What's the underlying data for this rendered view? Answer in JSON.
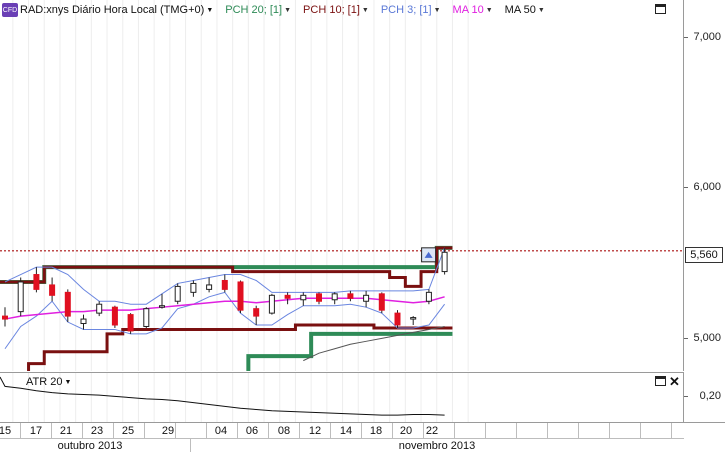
{
  "header": {
    "badge": "CFD",
    "symbol": "RAD:xnys Diário Hora Local (TMG+0)",
    "indicators": [
      {
        "label": "PCH 20; [1]",
        "color": "#2e8b57"
      },
      {
        "label": "PCH 10; [1]",
        "color": "#7a1010"
      },
      {
        "label": "PCH 3; [1]",
        "color": "#5a78d6"
      },
      {
        "label": "MA 10",
        "color": "#e020e0"
      },
      {
        "label": "MA 50",
        "color": "#111111"
      }
    ]
  },
  "price_axis": {
    "labels": [
      "7,000",
      "6,000",
      "5,000"
    ],
    "current_price": "5,560"
  },
  "atr": {
    "label": "ATR 20",
    "axis_label": "0,20"
  },
  "time_axis": {
    "days": [
      "15",
      "17",
      "21",
      "23",
      "25",
      "29",
      "04",
      "06",
      "08",
      "12",
      "14",
      "18",
      "20",
      "22"
    ],
    "months": [
      "outubro 2013",
      "novembro 2013"
    ]
  },
  "chart_data": {
    "type": "candlestick",
    "x": [
      "15",
      "16",
      "17",
      "18",
      "21",
      "22",
      "23",
      "24",
      "25",
      "28",
      "29",
      "30",
      "31",
      "01",
      "04",
      "05",
      "06",
      "07",
      "08",
      "11",
      "12",
      "13",
      "14",
      "15",
      "18",
      "19",
      "20",
      "21",
      "22"
    ],
    "candles": [
      {
        "o": 5.12,
        "h": 5.18,
        "l": 5.05,
        "c": 5.1,
        "up": false
      },
      {
        "o": 5.15,
        "h": 5.38,
        "l": 5.12,
        "c": 5.35,
        "up": true
      },
      {
        "o": 5.4,
        "h": 5.45,
        "l": 5.28,
        "c": 5.3,
        "up": false
      },
      {
        "o": 5.33,
        "h": 5.38,
        "l": 5.22,
        "c": 5.26,
        "up": false
      },
      {
        "o": 5.28,
        "h": 5.3,
        "l": 5.08,
        "c": 5.12,
        "up": false
      },
      {
        "o": 5.07,
        "h": 5.13,
        "l": 5.03,
        "c": 5.1,
        "up": true
      },
      {
        "o": 5.14,
        "h": 5.22,
        "l": 5.12,
        "c": 5.2,
        "up": true
      },
      {
        "o": 5.18,
        "h": 5.19,
        "l": 5.04,
        "c": 5.06,
        "up": false
      },
      {
        "o": 5.13,
        "h": 5.14,
        "l": 5.0,
        "c": 5.02,
        "up": false
      },
      {
        "o": 5.05,
        "h": 5.18,
        "l": 5.04,
        "c": 5.17,
        "up": true
      },
      {
        "o": 5.18,
        "h": 5.27,
        "l": 5.17,
        "c": 5.19,
        "up": true
      },
      {
        "o": 5.22,
        "h": 5.34,
        "l": 5.2,
        "c": 5.32,
        "up": true
      },
      {
        "o": 5.28,
        "h": 5.36,
        "l": 5.25,
        "c": 5.34,
        "up": true
      },
      {
        "o": 5.3,
        "h": 5.38,
        "l": 5.28,
        "c": 5.33,
        "up": true
      },
      {
        "o": 5.36,
        "h": 5.4,
        "l": 5.28,
        "c": 5.3,
        "up": false
      },
      {
        "o": 5.35,
        "h": 5.36,
        "l": 5.14,
        "c": 5.16,
        "up": false
      },
      {
        "o": 5.17,
        "h": 5.19,
        "l": 5.06,
        "c": 5.12,
        "up": false
      },
      {
        "o": 5.14,
        "h": 5.27,
        "l": 5.13,
        "c": 5.26,
        "up": true
      },
      {
        "o": 5.26,
        "h": 5.28,
        "l": 5.2,
        "c": 5.24,
        "up": false
      },
      {
        "o": 5.23,
        "h": 5.28,
        "l": 5.19,
        "c": 5.26,
        "up": true
      },
      {
        "o": 5.27,
        "h": 5.28,
        "l": 5.2,
        "c": 5.22,
        "up": false
      },
      {
        "o": 5.23,
        "h": 5.28,
        "l": 5.2,
        "c": 5.27,
        "up": true
      },
      {
        "o": 5.27,
        "h": 5.29,
        "l": 5.22,
        "c": 5.24,
        "up": false
      },
      {
        "o": 5.22,
        "h": 5.29,
        "l": 5.18,
        "c": 5.26,
        "up": true
      },
      {
        "o": 5.27,
        "h": 5.28,
        "l": 5.14,
        "c": 5.16,
        "up": false
      },
      {
        "o": 5.14,
        "h": 5.16,
        "l": 5.04,
        "c": 5.06,
        "up": false
      },
      {
        "o": 5.1,
        "h": 5.12,
        "l": 5.06,
        "c": 5.11,
        "up": true
      },
      {
        "o": 5.22,
        "h": 5.3,
        "l": 5.2,
        "c": 5.28,
        "up": true
      },
      {
        "o": 5.42,
        "h": 5.58,
        "l": 5.4,
        "c": 5.55,
        "up": true
      }
    ],
    "pch20_upper": [
      5.35,
      5.35,
      5.35,
      5.45,
      5.45,
      5.45,
      5.45,
      5.45,
      5.45,
      5.45,
      5.45,
      5.45,
      5.45,
      5.45,
      5.45,
      5.45,
      5.45,
      5.45,
      5.45,
      5.45,
      5.45,
      5.45,
      5.45,
      5.45,
      5.45,
      5.45,
      5.45,
      5.45,
      5.58
    ],
    "pch20_lower": [
      4.7,
      4.7,
      4.7,
      4.7,
      4.7,
      4.7,
      4.7,
      4.7,
      4.7,
      4.7,
      4.7,
      4.7,
      4.7,
      4.7,
      4.7,
      4.7,
      4.85,
      4.85,
      4.85,
      4.85,
      5.0,
      5.0,
      5.0,
      5.0,
      5.0,
      5.0,
      5.0,
      5.0,
      5.0
    ],
    "pch10_upper": [
      5.35,
      5.35,
      5.35,
      5.45,
      5.45,
      5.45,
      5.45,
      5.45,
      5.45,
      5.45,
      5.45,
      5.45,
      5.45,
      5.45,
      5.45,
      5.42,
      5.42,
      5.42,
      5.42,
      5.42,
      5.42,
      5.42,
      5.42,
      5.42,
      5.42,
      5.38,
      5.32,
      5.42,
      5.58
    ],
    "pch10_lower": [
      4.7,
      4.7,
      4.8,
      4.88,
      4.88,
      4.88,
      4.88,
      5.0,
      5.03,
      5.03,
      5.03,
      5.03,
      5.03,
      5.03,
      5.03,
      5.03,
      5.03,
      5.03,
      5.03,
      5.06,
      5.06,
      5.06,
      5.06,
      5.06,
      5.04,
      5.04,
      5.04,
      5.04,
      5.04
    ],
    "pch3_upper": [
      5.35,
      5.4,
      5.45,
      5.45,
      5.4,
      5.3,
      5.22,
      5.22,
      5.2,
      5.2,
      5.27,
      5.34,
      5.36,
      5.38,
      5.4,
      5.4,
      5.36,
      5.28,
      5.28,
      5.28,
      5.28,
      5.28,
      5.29,
      5.29,
      5.29,
      5.29,
      5.29,
      5.3,
      5.58
    ],
    "pch3_lower": [
      4.9,
      5.05,
      5.12,
      5.22,
      5.08,
      5.03,
      5.03,
      5.03,
      5.0,
      5.0,
      5.04,
      5.17,
      5.2,
      5.25,
      5.28,
      5.14,
      5.06,
      5.06,
      5.13,
      5.19,
      5.19,
      5.19,
      5.2,
      5.18,
      5.14,
      5.04,
      5.04,
      5.06,
      5.2
    ],
    "ma10": [
      5.1,
      5.12,
      5.13,
      5.14,
      5.15,
      5.15,
      5.16,
      5.16,
      5.16,
      5.17,
      5.18,
      5.19,
      5.2,
      5.21,
      5.22,
      5.22,
      5.21,
      5.22,
      5.23,
      5.24,
      5.24,
      5.24,
      5.24,
      5.24,
      5.23,
      5.22,
      5.21,
      5.22,
      5.25
    ],
    "ma50": [
      null,
      null,
      null,
      null,
      null,
      null,
      null,
      null,
      null,
      null,
      null,
      null,
      null,
      null,
      null,
      null,
      null,
      null,
      null,
      4.82,
      4.87,
      4.9,
      4.93,
      4.95,
      4.97,
      4.99,
      5.01,
      5.03,
      5.05
    ],
    "atr": [
      0.265,
      0.262,
      0.258,
      0.255,
      0.253,
      0.252,
      0.251,
      0.249,
      0.247,
      0.245,
      0.244,
      0.242,
      0.239,
      0.236,
      0.233,
      0.23,
      0.228,
      0.226,
      0.225,
      0.224,
      0.223,
      0.222,
      0.221,
      0.22,
      0.219,
      0.219,
      0.22,
      0.22,
      0.219
    ],
    "price_ylim": [
      4.75,
      7.25
    ],
    "atr_ylim": [
      0.2,
      0.28
    ],
    "current_price": 5.56
  }
}
